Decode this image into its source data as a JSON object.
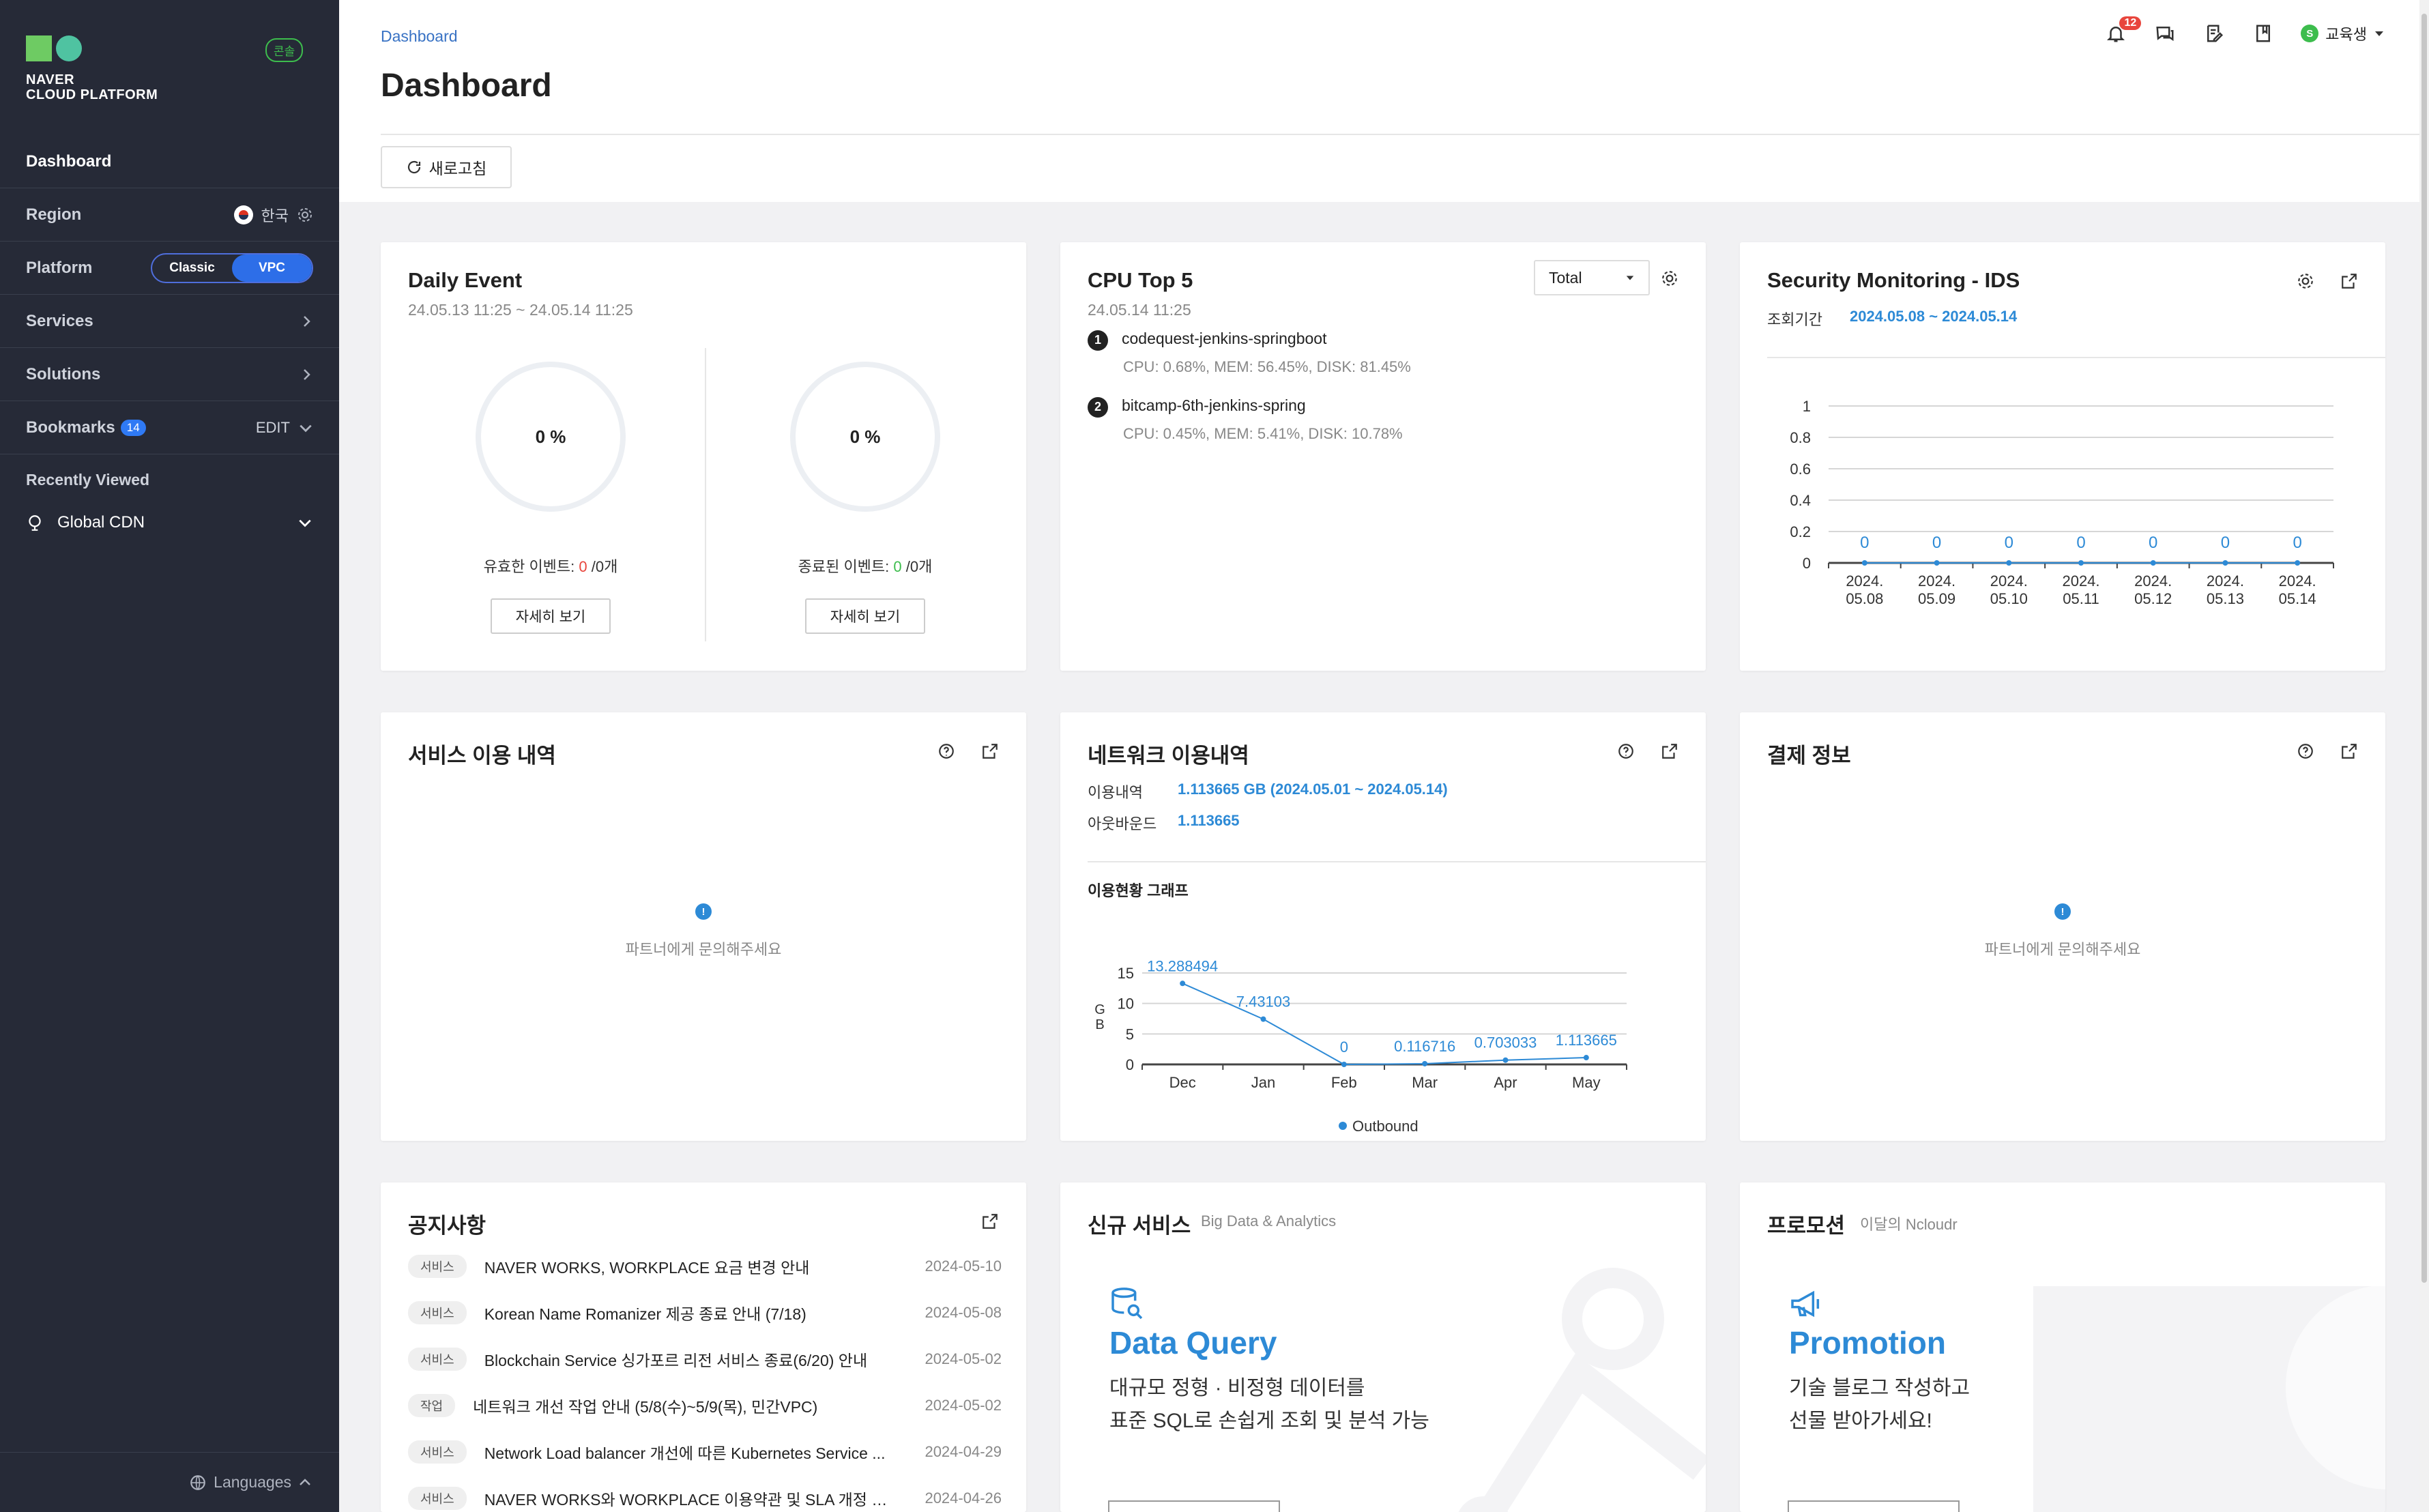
{
  "sidebar": {
    "logo": {
      "line1": "NAVER",
      "line2": "CLOUD PLATFORM"
    },
    "console_badge": "콘솔",
    "dashboard": "Dashboard",
    "region": {
      "label": "Region",
      "value": "한국"
    },
    "platform": {
      "label": "Platform",
      "options": [
        "Classic",
        "VPC"
      ],
      "selected": "VPC"
    },
    "services": "Services",
    "solutions": "Solutions",
    "bookmarks": {
      "label": "Bookmarks",
      "count": "14",
      "edit": "EDIT"
    },
    "recently_viewed": {
      "label": "Recently Viewed",
      "items": [
        "Global CDN"
      ]
    },
    "languages": "Languages"
  },
  "header": {
    "breadcrumb": "Dashboard",
    "title": "Dashboard",
    "refresh": "새로고침",
    "notification_count": "12",
    "user": {
      "initial": "S",
      "name": "교육생"
    }
  },
  "daily_event": {
    "title": "Daily Event",
    "range": "24.05.13 11:25 ~ 24.05.14 11:25",
    "valid": {
      "percent": "0 %",
      "label": "유효한 이벤트:",
      "count": "0",
      "total": "/0개",
      "button": "자세히 보기"
    },
    "closed": {
      "percent": "0 %",
      "label": "종료된 이벤트:",
      "count": "0",
      "total": "/0개",
      "button": "자세히 보기"
    }
  },
  "cpu_top5": {
    "title": "CPU Top 5",
    "time": "24.05.14 11:25",
    "filter": "Total",
    "items": [
      {
        "rank": "1",
        "name": "codequest-jenkins-springboot",
        "stats": "CPU: 0.68%, MEM: 56.45%, DISK: 81.45%"
      },
      {
        "rank": "2",
        "name": "bitcamp-6th-jenkins-spring",
        "stats": "CPU: 0.45%, MEM: 5.41%, DISK: 10.78%"
      }
    ]
  },
  "security": {
    "title": "Security Monitoring - IDS",
    "period_label": "조회기간",
    "period": "2024.05.08 ~ 2024.05.14"
  },
  "service_usage": {
    "title": "서비스 이용 내역",
    "message": "파트너에게 문의해주세요"
  },
  "network": {
    "title": "네트워크 이용내역",
    "usage_label": "이용내역",
    "usage_value": "1.113665 GB (2024.05.01 ~ 2024.05.14)",
    "outbound_label": "아웃바운드",
    "outbound_value": "1.113665",
    "graph_title": "이용현황 그래프"
  },
  "billing": {
    "title": "결제 정보",
    "message": "파트너에게 문의해주세요"
  },
  "notices": {
    "title": "공지사항",
    "items": [
      {
        "tag": "서비스",
        "title": "NAVER WORKS, WORKPLACE 요금 변경 안내",
        "date": "2024-05-10"
      },
      {
        "tag": "서비스",
        "title": "Korean Name Romanizer 제공 종료 안내 (7/18)",
        "date": "2024-05-08"
      },
      {
        "tag": "서비스",
        "title": "Blockchain Service 싱가포르 리전 서비스 종료(6/20) 안내",
        "date": "2024-05-02"
      },
      {
        "tag": "작업",
        "title": "네트워크 개선 작업 안내 (5/8(수)~5/9(목), 민간VPC)",
        "date": "2024-05-02"
      },
      {
        "tag": "서비스",
        "title": "Network Load balancer 개선에 따른 Kubernetes Service ...",
        "date": "2024-04-29"
      },
      {
        "tag": "서비스",
        "title": "NAVER WORKS와 WORKPLACE 이용약관 및 SLA 개정 공지문",
        "date": "2024-04-26"
      }
    ]
  },
  "new_service": {
    "title": "신규 서비스",
    "category": "Big Data & Analytics",
    "name": "Data Query",
    "desc1": "대규모 정형 · 비정형 데이터를",
    "desc2": "표준 SQL로 손쉽게 조회 및 분석 가능"
  },
  "promotion": {
    "title": "프로모션",
    "subtitle": "이달의 Ncloudr",
    "name": "Promotion",
    "desc1": "기술 블로그 작성하고",
    "desc2": "선물 받아가세요!"
  },
  "colors": {
    "sidebar": "#262a37",
    "accent": "#2d8ad6",
    "vpc_toggle": "#2d6ee8",
    "badge_red": "#e8453c",
    "green": "#3dbd4d"
  },
  "chart_data": [
    {
      "type": "line",
      "title": "",
      "x": [
        "2024.\n05.08",
        "2024.\n05.09",
        "2024.\n05.10",
        "2024.\n05.11",
        "2024.\n05.12",
        "2024.\n05.13",
        "2024.\n05.14"
      ],
      "x_labels_line1": [
        "2024.",
        "2024.",
        "2024.",
        "2024.",
        "2024.",
        "2024.",
        "2024."
      ],
      "x_labels_line2": [
        "05.08",
        "05.09",
        "05.10",
        "05.11",
        "05.12",
        "05.13",
        "05.14"
      ],
      "series": [
        {
          "values": [
            0,
            0,
            0,
            0,
            0,
            0,
            0
          ]
        }
      ],
      "data_labels": [
        "0",
        "0",
        "0",
        "0",
        "0",
        "0",
        "0"
      ],
      "yticks": [
        "0",
        "0.2",
        "0.4",
        "0.6",
        "0.8",
        "1"
      ],
      "ylim": [
        0,
        1
      ],
      "grid": true
    },
    {
      "type": "line",
      "title": "이용현황 그래프",
      "ylabel": "GB",
      "categories": [
        "Dec",
        "Jan",
        "Feb",
        "Mar",
        "Apr",
        "May"
      ],
      "series": [
        {
          "name": "Outbound",
          "values": [
            13.288494,
            7.43103,
            0,
            0.116716,
            0.703033,
            1.113665
          ]
        }
      ],
      "data_labels": [
        "13.288494",
        "7.43103",
        "0",
        "0.116716",
        "0.703033",
        "1.113665"
      ],
      "yticks": [
        "0",
        "5",
        "10",
        "15"
      ],
      "ylim": [
        0,
        15
      ],
      "grid": true,
      "legend": "bottom"
    }
  ]
}
